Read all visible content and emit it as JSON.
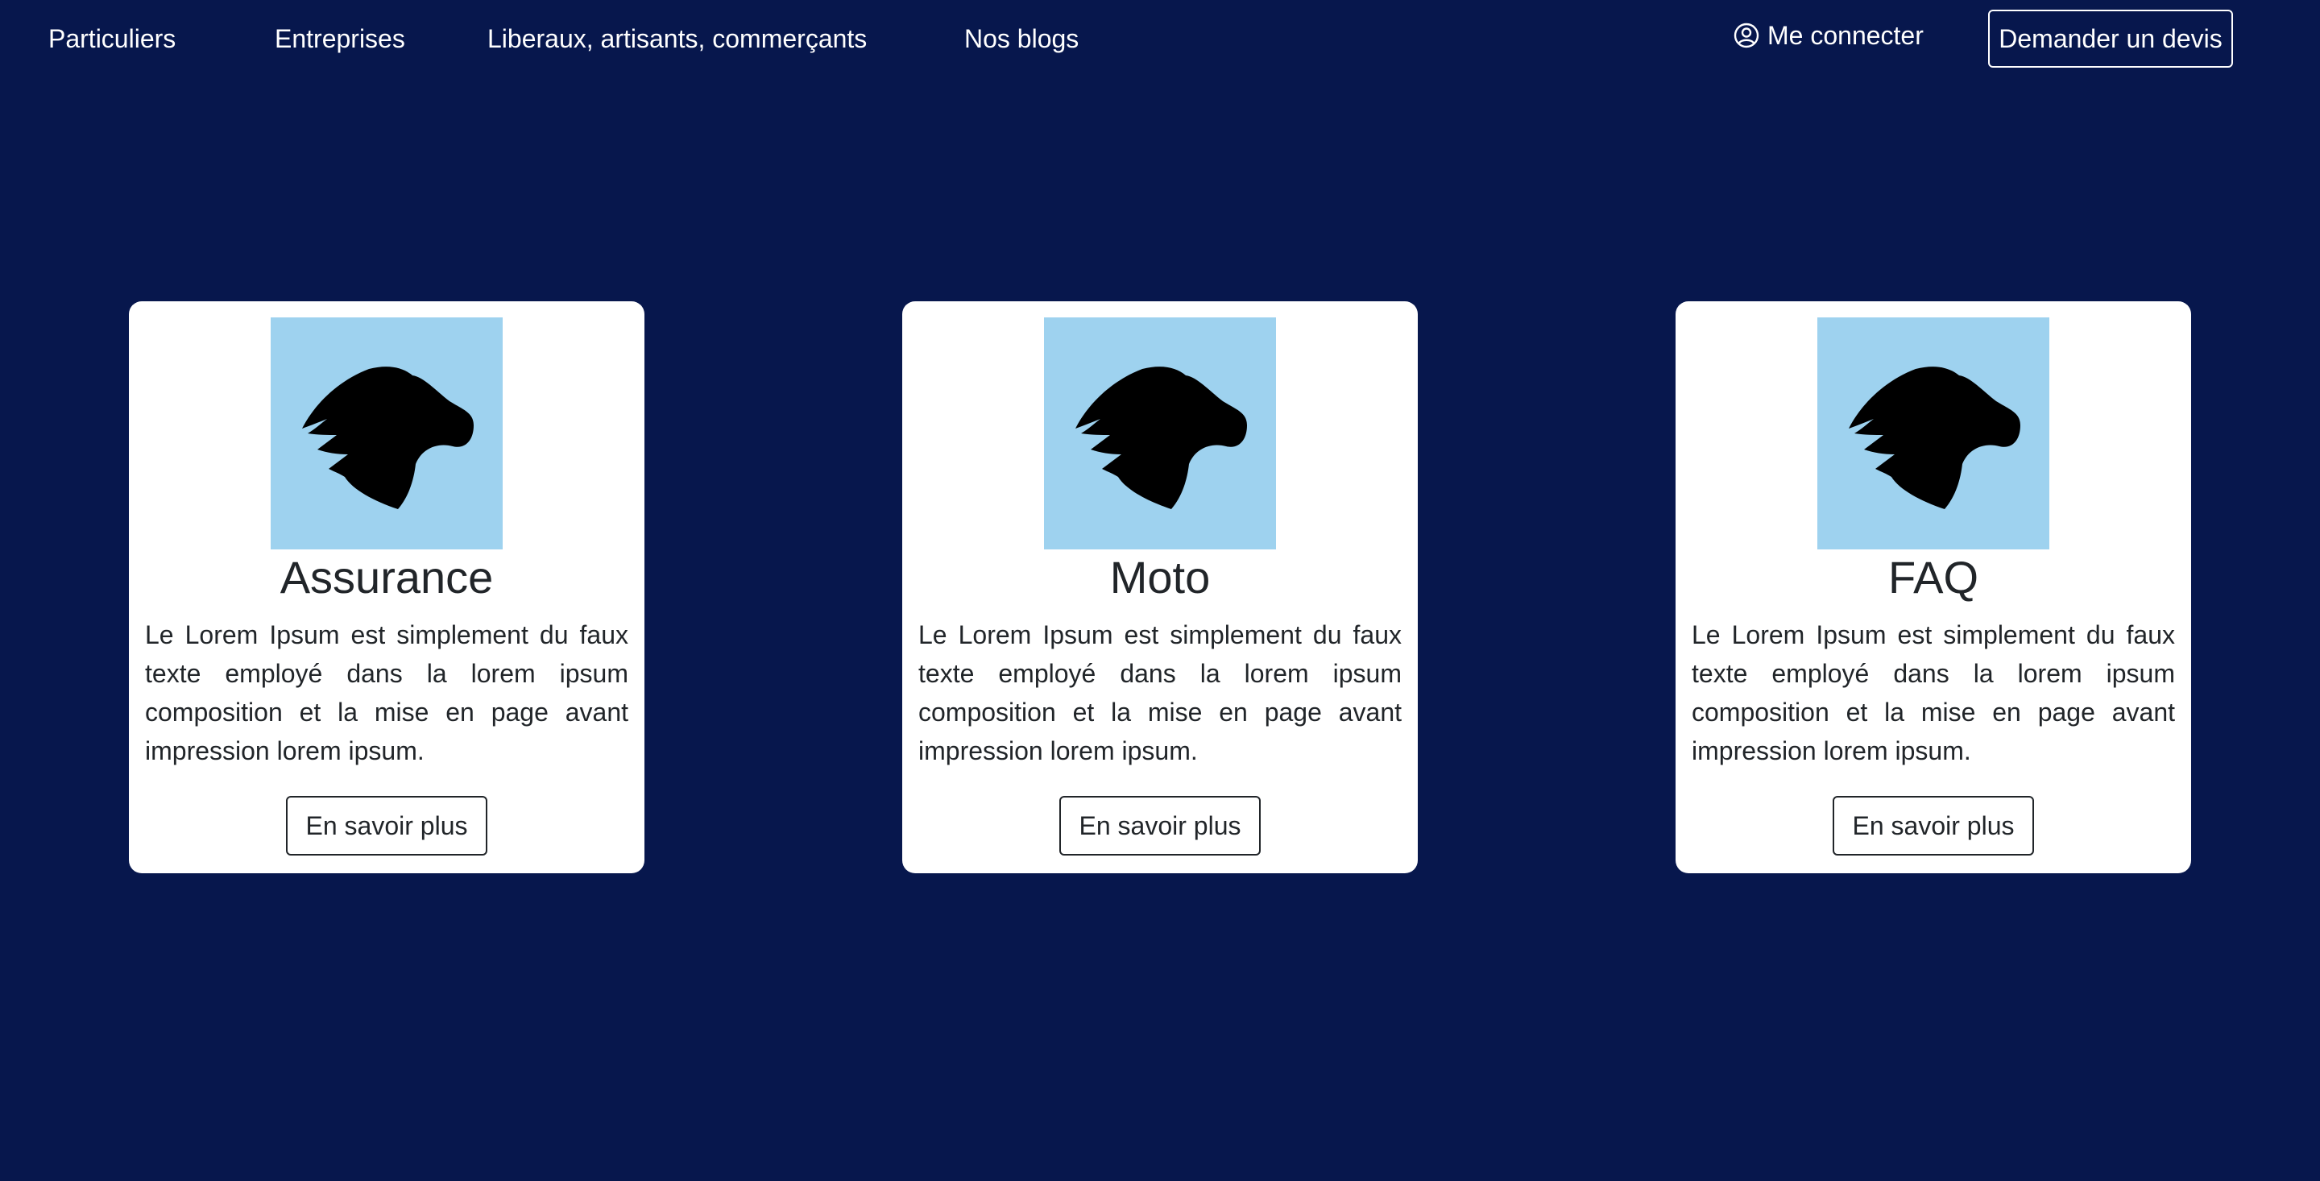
{
  "nav": {
    "links": [
      "Particuliers",
      "Entreprises",
      "Liberaux, artisants, commerçants",
      "Nos blogs"
    ],
    "login_label": "Me connecter",
    "login_icon": "user-circle-icon",
    "quote_button_label": "Demander un devis"
  },
  "cards": [
    {
      "title": "Assurance",
      "text": "Le Lorem Ipsum est simplement du faux texte employé dans la lorem ipsum composition et la mise en page avant impression lorem ipsum.",
      "button_label": "En savoir plus",
      "image_icon": "animal-head-silhouette-icon"
    },
    {
      "title": "Moto",
      "text": "Le Lorem Ipsum est simplement du faux texte employé dans la lorem ipsum composition et la mise en page avant impression lorem ipsum.",
      "button_label": "En savoir plus",
      "image_icon": "animal-head-silhouette-icon"
    },
    {
      "title": "FAQ",
      "text": "Le Lorem Ipsum est simplement du faux texte employé dans la lorem ipsum composition et la mise en page avant impression lorem ipsum.",
      "button_label": "En savoir plus",
      "image_icon": "animal-head-silhouette-icon"
    }
  ],
  "colors": {
    "page_background": "#07174d",
    "card_background": "#ffffff",
    "image_background": "#9ed2ef",
    "text_dark": "#212529",
    "text_light": "#ffffff"
  }
}
